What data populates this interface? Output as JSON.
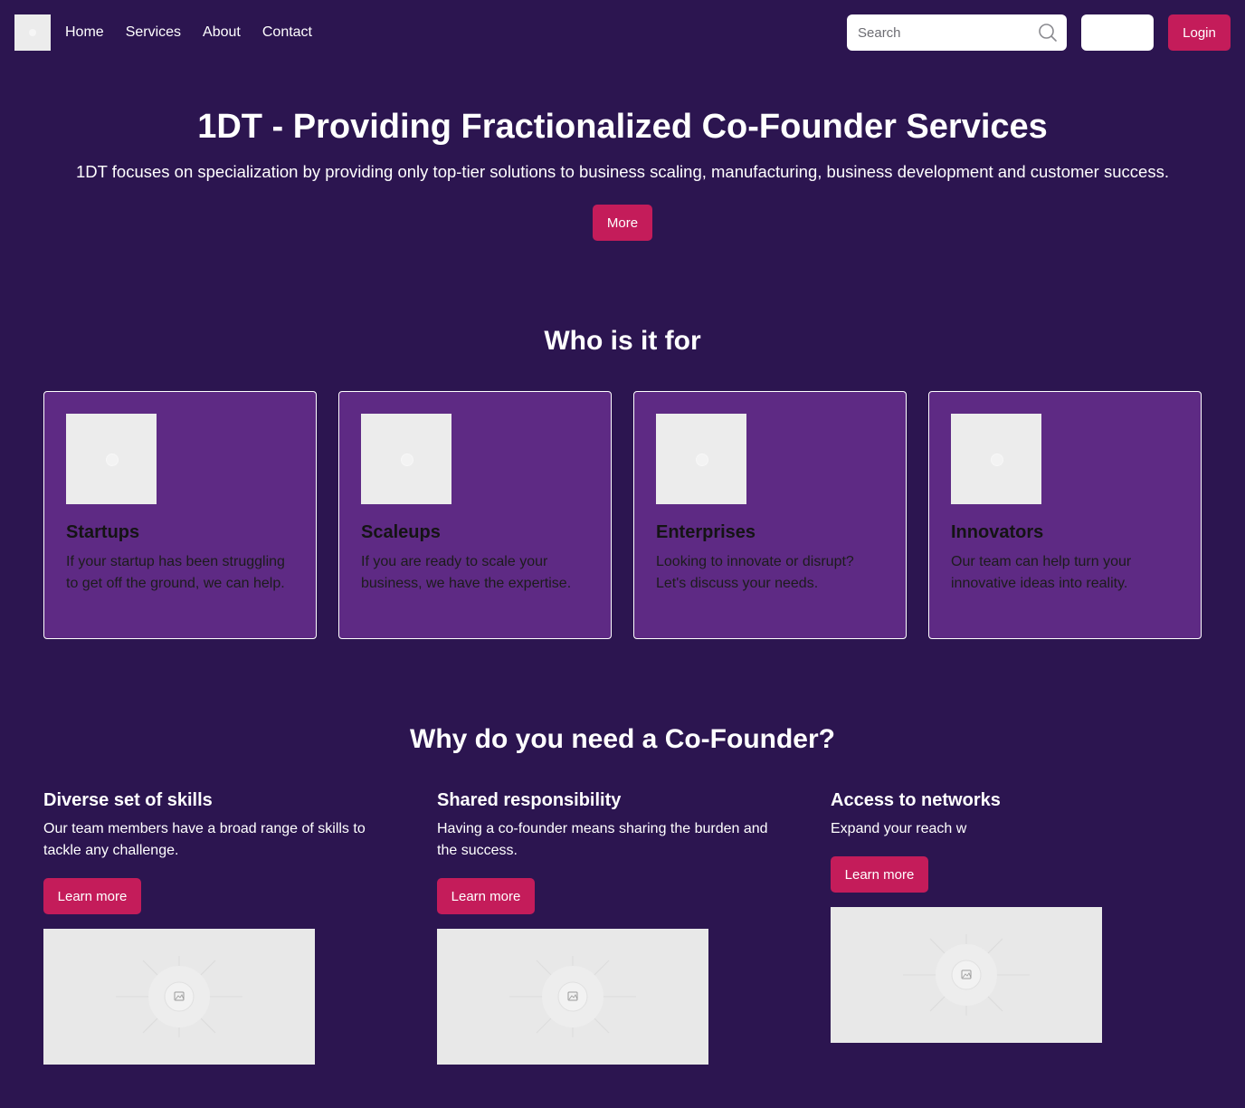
{
  "nav": {
    "links": [
      "Home",
      "Services",
      "About",
      "Contact"
    ],
    "search_placeholder": "Search",
    "login_label": "Login"
  },
  "hero": {
    "title": "1DT - Providing Fractionalized Co-Founder Services",
    "subtitle": "1DT focuses on specialization by providing only top-tier solutions to business scaling, manufacturing, business development and customer success.",
    "button_label": "More"
  },
  "who": {
    "title": "Who is it for",
    "cards": [
      {
        "title": "Startups",
        "text": "If your startup has been struggling to get off the ground, we can help."
      },
      {
        "title": "Scaleups",
        "text": "If you are ready to scale your business, we have the expertise."
      },
      {
        "title": "Enterprises",
        "text": "Looking to innovate or disrupt? Let's discuss your needs."
      },
      {
        "title": "Innovators",
        "text": "Our team can help turn your innovative ideas into reality."
      }
    ]
  },
  "why": {
    "title": "Why do you need a Co-Founder?",
    "features": [
      {
        "title": "Diverse set of skills",
        "text": "Our team members have a broad range of skills to tackle any challenge.",
        "button_label": "Learn more"
      },
      {
        "title": "Shared responsibility",
        "text": "Having a co-founder means sharing the burden and the success.",
        "button_label": "Learn more"
      },
      {
        "title": "Access to networks",
        "text": "Expand your reach w",
        "button_label": "Learn more"
      }
    ]
  },
  "colors": {
    "background": "#2c1550",
    "card_background": "#5e2a84",
    "accent": "#c41c5a"
  }
}
